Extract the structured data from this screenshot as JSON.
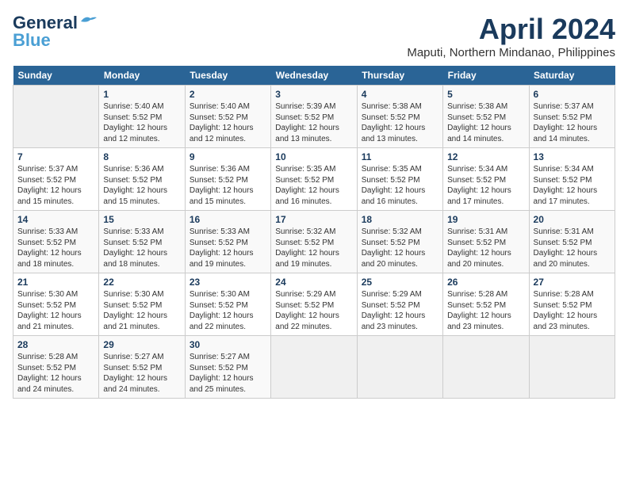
{
  "logo": {
    "line1": "General",
    "line2": "Blue"
  },
  "title": "April 2024",
  "location": "Maputi, Northern Mindanao, Philippines",
  "days_of_week": [
    "Sunday",
    "Monday",
    "Tuesday",
    "Wednesday",
    "Thursday",
    "Friday",
    "Saturday"
  ],
  "weeks": [
    [
      {
        "day": "",
        "info": ""
      },
      {
        "day": "1",
        "info": "Sunrise: 5:40 AM\nSunset: 5:52 PM\nDaylight: 12 hours\nand 12 minutes."
      },
      {
        "day": "2",
        "info": "Sunrise: 5:40 AM\nSunset: 5:52 PM\nDaylight: 12 hours\nand 12 minutes."
      },
      {
        "day": "3",
        "info": "Sunrise: 5:39 AM\nSunset: 5:52 PM\nDaylight: 12 hours\nand 13 minutes."
      },
      {
        "day": "4",
        "info": "Sunrise: 5:38 AM\nSunset: 5:52 PM\nDaylight: 12 hours\nand 13 minutes."
      },
      {
        "day": "5",
        "info": "Sunrise: 5:38 AM\nSunset: 5:52 PM\nDaylight: 12 hours\nand 14 minutes."
      },
      {
        "day": "6",
        "info": "Sunrise: 5:37 AM\nSunset: 5:52 PM\nDaylight: 12 hours\nand 14 minutes."
      }
    ],
    [
      {
        "day": "7",
        "info": "Sunrise: 5:37 AM\nSunset: 5:52 PM\nDaylight: 12 hours\nand 15 minutes."
      },
      {
        "day": "8",
        "info": "Sunrise: 5:36 AM\nSunset: 5:52 PM\nDaylight: 12 hours\nand 15 minutes."
      },
      {
        "day": "9",
        "info": "Sunrise: 5:36 AM\nSunset: 5:52 PM\nDaylight: 12 hours\nand 15 minutes."
      },
      {
        "day": "10",
        "info": "Sunrise: 5:35 AM\nSunset: 5:52 PM\nDaylight: 12 hours\nand 16 minutes."
      },
      {
        "day": "11",
        "info": "Sunrise: 5:35 AM\nSunset: 5:52 PM\nDaylight: 12 hours\nand 16 minutes."
      },
      {
        "day": "12",
        "info": "Sunrise: 5:34 AM\nSunset: 5:52 PM\nDaylight: 12 hours\nand 17 minutes."
      },
      {
        "day": "13",
        "info": "Sunrise: 5:34 AM\nSunset: 5:52 PM\nDaylight: 12 hours\nand 17 minutes."
      }
    ],
    [
      {
        "day": "14",
        "info": "Sunrise: 5:33 AM\nSunset: 5:52 PM\nDaylight: 12 hours\nand 18 minutes."
      },
      {
        "day": "15",
        "info": "Sunrise: 5:33 AM\nSunset: 5:52 PM\nDaylight: 12 hours\nand 18 minutes."
      },
      {
        "day": "16",
        "info": "Sunrise: 5:33 AM\nSunset: 5:52 PM\nDaylight: 12 hours\nand 19 minutes."
      },
      {
        "day": "17",
        "info": "Sunrise: 5:32 AM\nSunset: 5:52 PM\nDaylight: 12 hours\nand 19 minutes."
      },
      {
        "day": "18",
        "info": "Sunrise: 5:32 AM\nSunset: 5:52 PM\nDaylight: 12 hours\nand 20 minutes."
      },
      {
        "day": "19",
        "info": "Sunrise: 5:31 AM\nSunset: 5:52 PM\nDaylight: 12 hours\nand 20 minutes."
      },
      {
        "day": "20",
        "info": "Sunrise: 5:31 AM\nSunset: 5:52 PM\nDaylight: 12 hours\nand 20 minutes."
      }
    ],
    [
      {
        "day": "21",
        "info": "Sunrise: 5:30 AM\nSunset: 5:52 PM\nDaylight: 12 hours\nand 21 minutes."
      },
      {
        "day": "22",
        "info": "Sunrise: 5:30 AM\nSunset: 5:52 PM\nDaylight: 12 hours\nand 21 minutes."
      },
      {
        "day": "23",
        "info": "Sunrise: 5:30 AM\nSunset: 5:52 PM\nDaylight: 12 hours\nand 22 minutes."
      },
      {
        "day": "24",
        "info": "Sunrise: 5:29 AM\nSunset: 5:52 PM\nDaylight: 12 hours\nand 22 minutes."
      },
      {
        "day": "25",
        "info": "Sunrise: 5:29 AM\nSunset: 5:52 PM\nDaylight: 12 hours\nand 23 minutes."
      },
      {
        "day": "26",
        "info": "Sunrise: 5:28 AM\nSunset: 5:52 PM\nDaylight: 12 hours\nand 23 minutes."
      },
      {
        "day": "27",
        "info": "Sunrise: 5:28 AM\nSunset: 5:52 PM\nDaylight: 12 hours\nand 23 minutes."
      }
    ],
    [
      {
        "day": "28",
        "info": "Sunrise: 5:28 AM\nSunset: 5:52 PM\nDaylight: 12 hours\nand 24 minutes."
      },
      {
        "day": "29",
        "info": "Sunrise: 5:27 AM\nSunset: 5:52 PM\nDaylight: 12 hours\nand 24 minutes."
      },
      {
        "day": "30",
        "info": "Sunrise: 5:27 AM\nSunset: 5:52 PM\nDaylight: 12 hours\nand 25 minutes."
      },
      {
        "day": "",
        "info": ""
      },
      {
        "day": "",
        "info": ""
      },
      {
        "day": "",
        "info": ""
      },
      {
        "day": "",
        "info": ""
      }
    ]
  ]
}
